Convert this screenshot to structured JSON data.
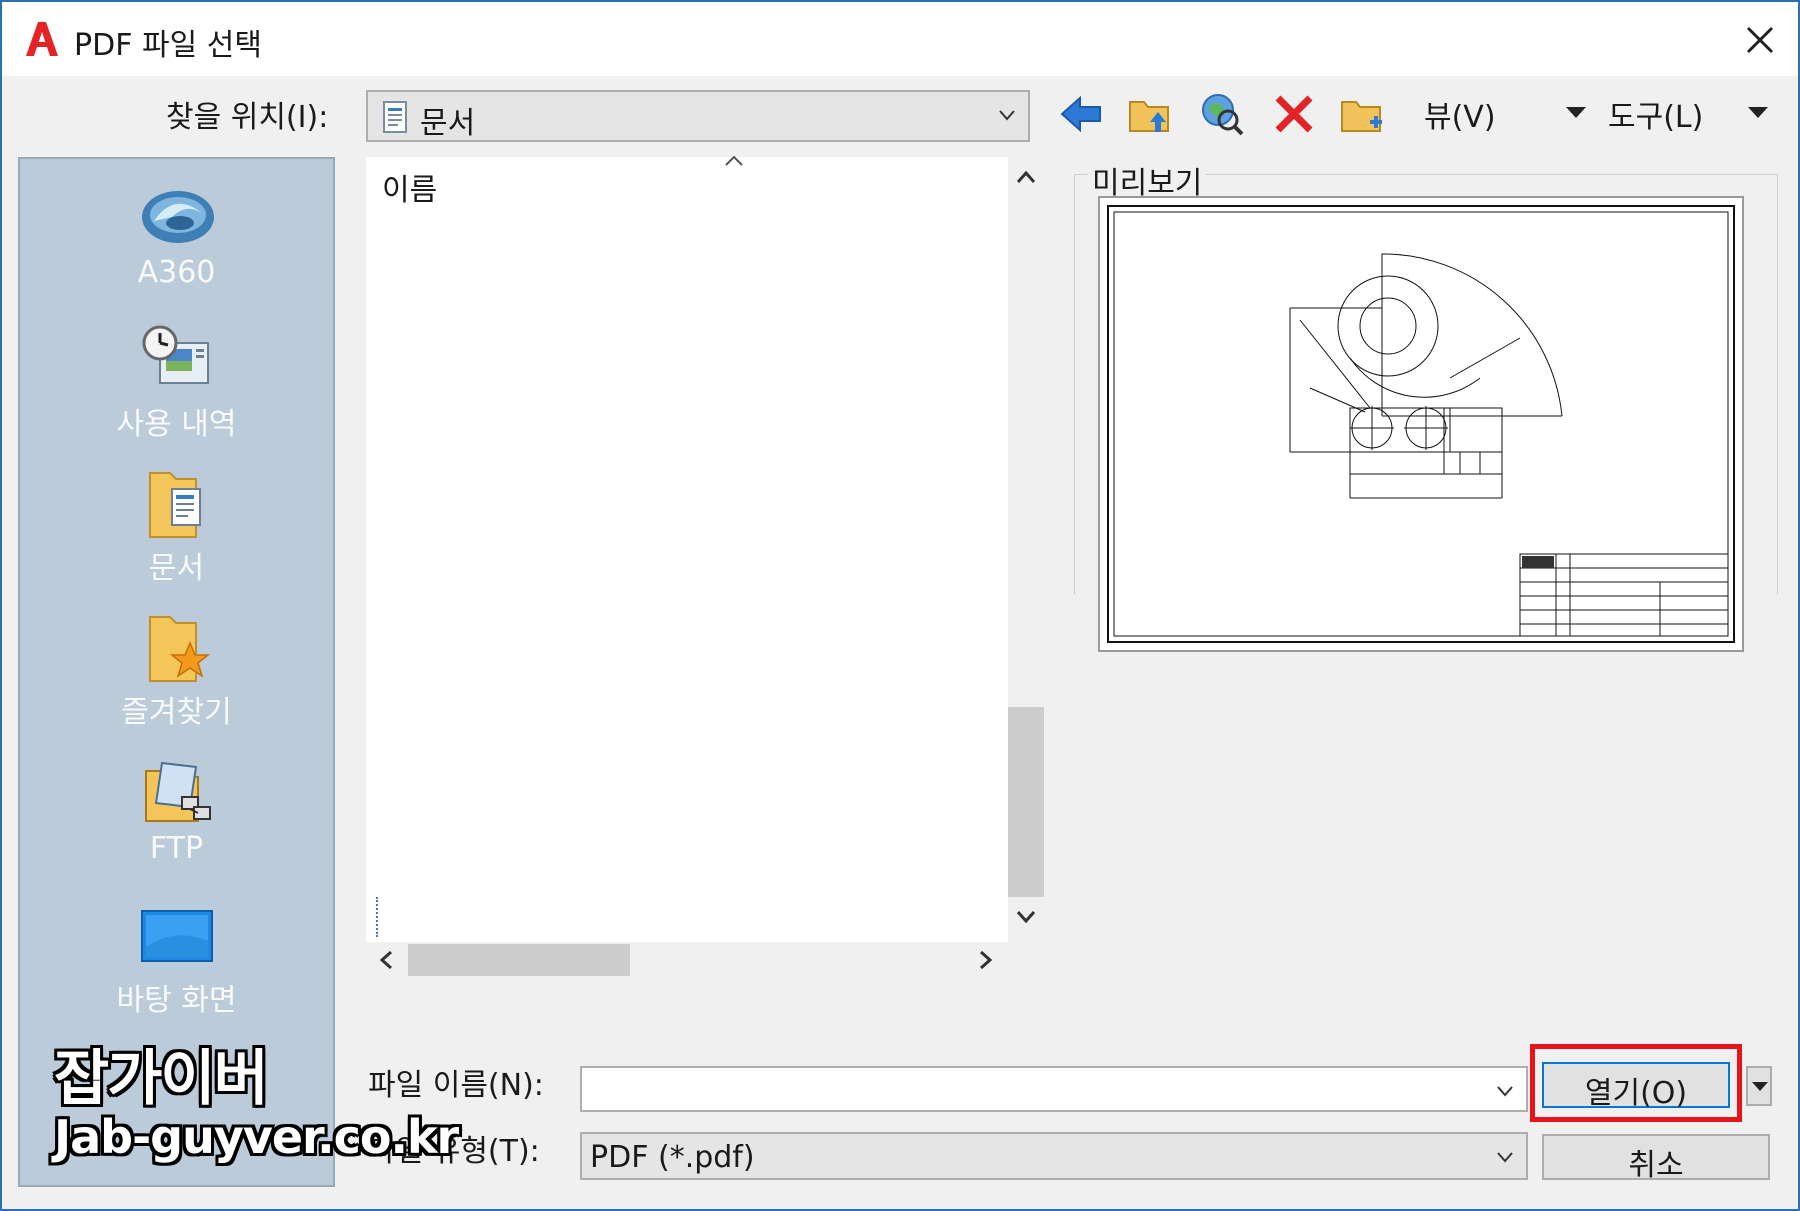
{
  "window": {
    "title": "PDF 파일 선택"
  },
  "toolbar": {
    "look_in_label": "찾을 위치(I):",
    "look_in_value": "문서",
    "view_label": "뷰(V)",
    "tools_label": "도구(L)"
  },
  "places": [
    {
      "label": "A360",
      "icon": "a360-cloud-icon"
    },
    {
      "label": "사용 내역",
      "icon": "history-icon"
    },
    {
      "label": "문서",
      "icon": "documents-folder-icon"
    },
    {
      "label": "즐겨찾기",
      "icon": "favorites-folder-icon"
    },
    {
      "label": "FTP",
      "icon": "ftp-folder-icon"
    },
    {
      "label": "바탕 화면",
      "icon": "desktop-icon"
    }
  ],
  "filelist": {
    "column_name": "이름"
  },
  "preview": {
    "label": "미리보기"
  },
  "bottom": {
    "file_name_label": "파일 이름(N):",
    "file_name_value": "",
    "file_type_label": "파일 유형(T):",
    "file_type_value": "PDF (*.pdf)",
    "open_button": "열기(O)",
    "cancel_button": "취소"
  },
  "watermark": {
    "line1": "잡가이버",
    "line2": "Jab-guyver.co.kr"
  },
  "colors": {
    "accent_border": "#2b6fb8",
    "places_bg": "#bccbda",
    "highlight": "#e8141b"
  }
}
